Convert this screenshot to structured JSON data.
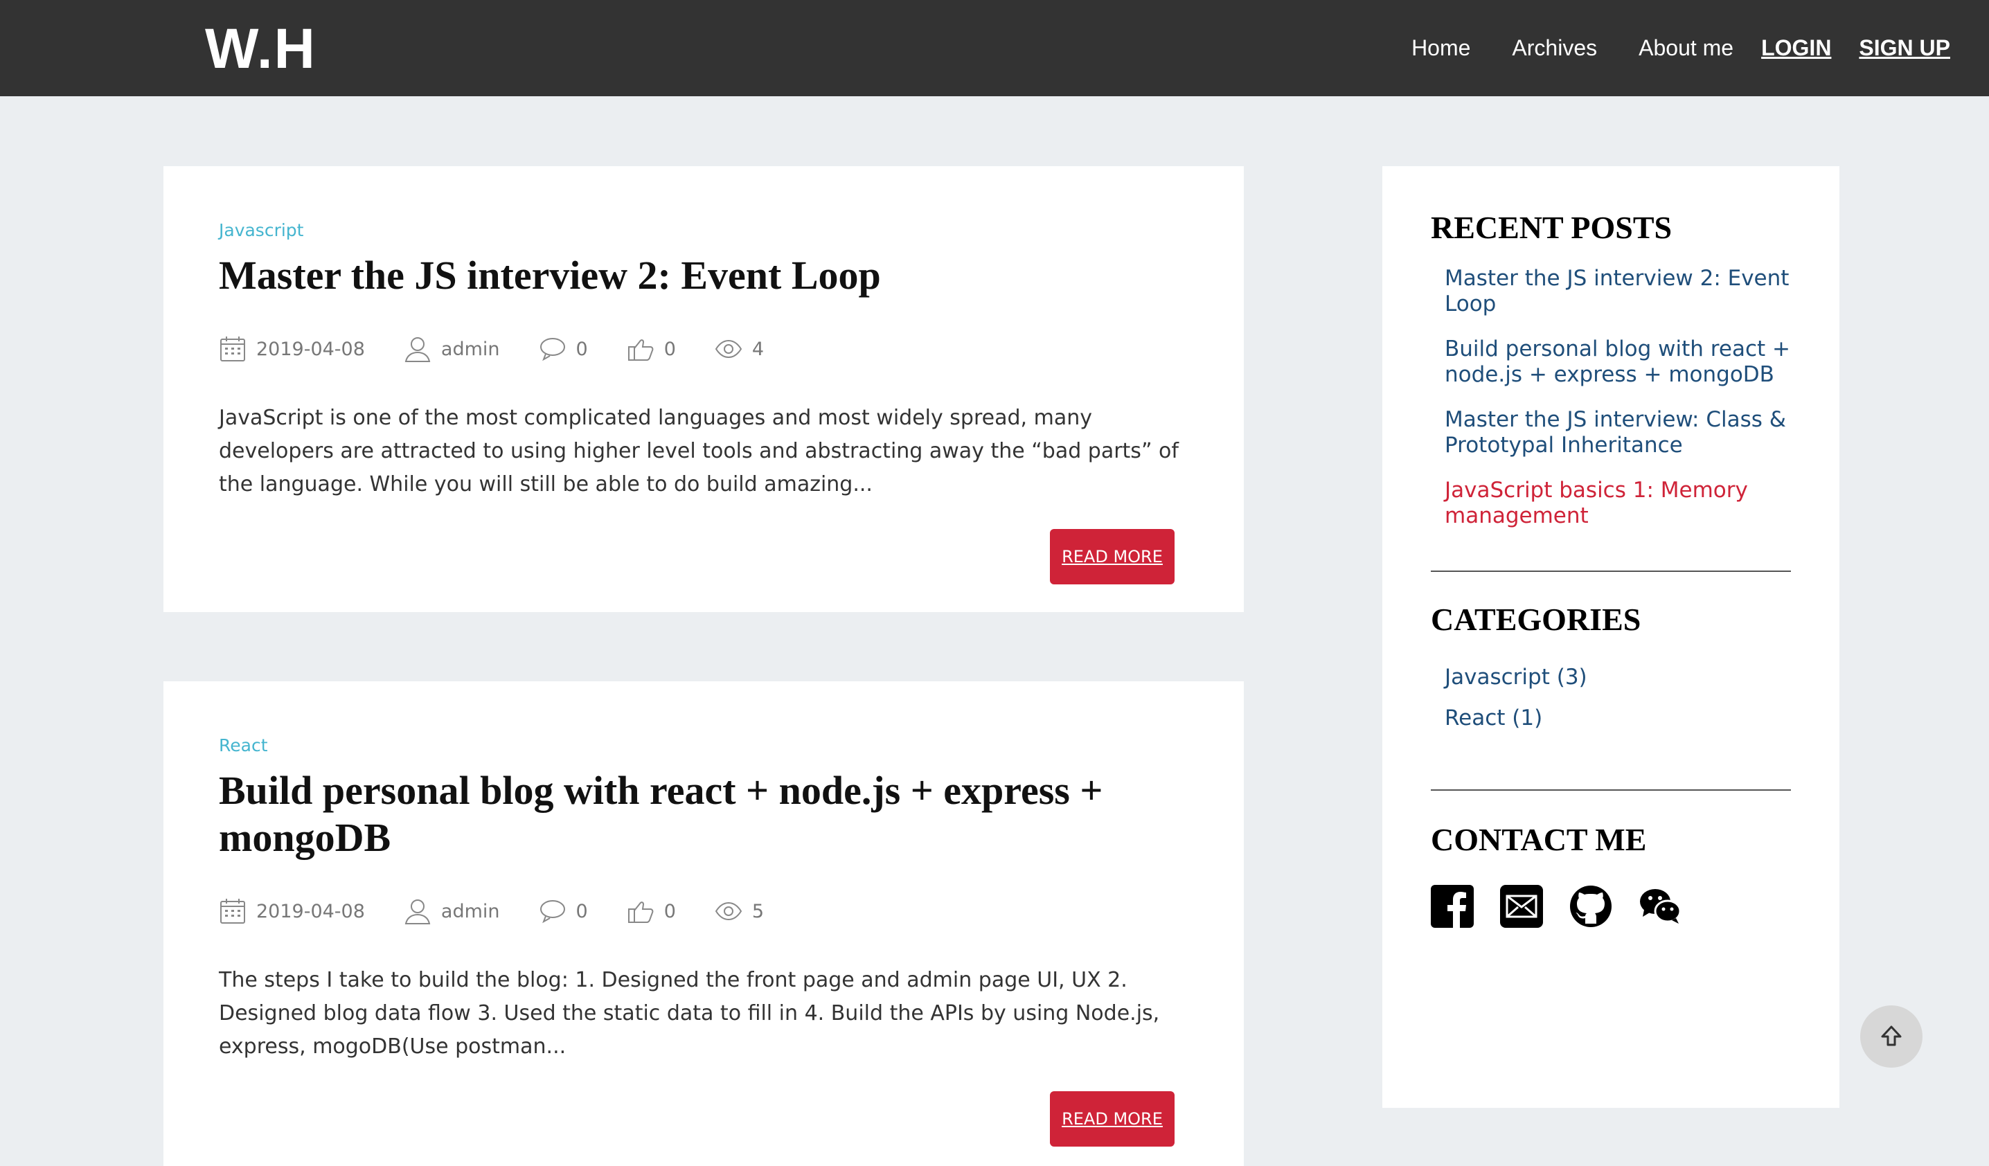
{
  "header": {
    "logo": "W.H",
    "nav": [
      "Home",
      "Archives",
      "About me"
    ],
    "login": "LOGIN",
    "signup": "SIGN UP"
  },
  "posts": [
    {
      "category": "Javascript",
      "title": "Master the JS interview 2: Event Loop",
      "date": "2019-04-08",
      "author": "admin",
      "comments": "0",
      "likes": "0",
      "views": "4",
      "excerpt": "JavaScript is one of the most complicated languages and most widely spread, many developers are attracted to using higher level tools and abstracting away the “bad parts” of the language. While you will still be able to do build amazing...",
      "read_more": "READ MORE"
    },
    {
      "category": "React",
      "title": "Build personal blog with react + node.js + express + mongoDB",
      "date": "2019-04-08",
      "author": "admin",
      "comments": "0",
      "likes": "0",
      "views": "5",
      "excerpt": "The steps I take to build the blog: 1. Designed the front page and admin page UI, UX 2. Designed blog data flow 3. Used the static data to fill in 4. Build the APIs by using Node.js, express, mogoDB(Use postman...",
      "read_more": "READ MORE"
    }
  ],
  "sidebar": {
    "recent_title": "RECENT POSTS",
    "recent": [
      "Master the JS interview 2: Event Loop",
      "Build personal blog with react + node.js + express + mongoDB",
      "Master the JS interview: Class & Prototypal Inheritance",
      "JavaScript basics 1: Memory management"
    ],
    "categories_title": "CATEGORIES",
    "categories": [
      "Javascript (3)",
      "React (1)"
    ],
    "contact_title": "CONTACT ME",
    "contact_icons": [
      "facebook-icon",
      "mail-icon",
      "github-icon",
      "wechat-icon"
    ]
  },
  "colors": {
    "header_bg": "#333333",
    "page_bg": "#ebeef1",
    "category": "#45b5cf",
    "link": "#1f4e7a",
    "accent": "#cf2338"
  }
}
